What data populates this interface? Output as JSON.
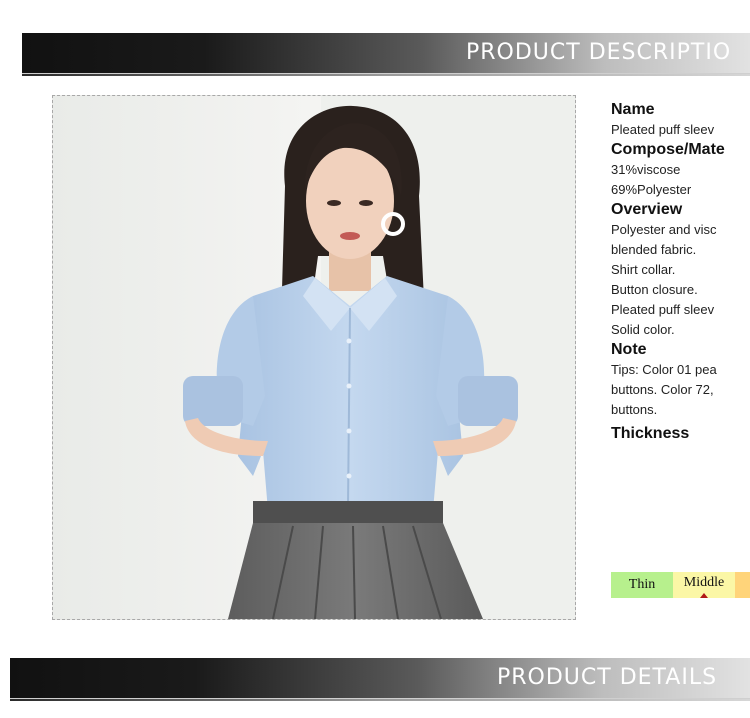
{
  "banners": {
    "description": "PRODUCT DESCRIPTIO",
    "details": "PRODUCT DETAILS"
  },
  "product": {
    "image_alt": "model-wearing-light-blue-puff-sleeve-shirt",
    "name_heading": "Name",
    "name_lines": [
      "Pleated puff sleev"
    ],
    "material_heading": "Compose/Mate",
    "material_lines": [
      "31%viscose",
      "69%Polyester"
    ],
    "overview_heading": "Overview",
    "overview_lines": [
      "Polyester and visc",
      "blended fabric.",
      "Shirt collar.",
      "Button closure.",
      "Pleated puff sleev",
      "Solid color."
    ],
    "note_heading": "Note",
    "note_lines": [
      "Tips: Color 01 pea",
      "buttons. Color 72,",
      "buttons."
    ],
    "thickness_heading": "Thickness",
    "thickness_options": [
      "Thin",
      "Middle",
      ""
    ],
    "thickness_selected": "Middle",
    "colors": {
      "thin": "#b7f08d",
      "middle": "#fbf7a6",
      "thick": "#ffd47a",
      "marker": "#b01818",
      "shirt": "#bcd3ec",
      "skirt": "#6f6f6f"
    }
  }
}
